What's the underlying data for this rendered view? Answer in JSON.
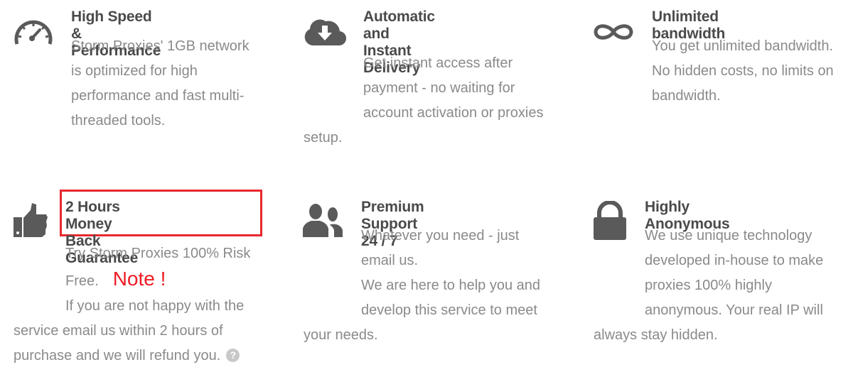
{
  "colors": {
    "icon": "#5a5a5a",
    "title": "#4a4a4a",
    "text": "#8a8a8a",
    "annotation": "#ee1c25"
  },
  "features": [
    {
      "icon": "speedometer-icon",
      "title": "High Speed & Performance",
      "lines": [
        "Storm Proxies' 1GB network",
        "is optimized for high",
        "performance and fast multi-",
        "threaded tools."
      ]
    },
    {
      "icon": "cloud-download-icon",
      "title_lines": [
        "Automatic and Instant",
        "Delivery"
      ],
      "lines": [
        "Get instant access after",
        "payment - no waiting for",
        "account activation or proxies",
        "setup."
      ]
    },
    {
      "icon": "infinity-icon",
      "title": "Unlimited bandwidth",
      "lines": [
        "You get unlimited bandwidth.",
        "No hidden costs, no limits on",
        "bandwidth."
      ]
    },
    {
      "icon": "thumbs-up-icon",
      "title_lines": [
        "2 Hours Money Back",
        "Guarantee"
      ],
      "lines": [
        "Try Storm Proxies 100% Risk",
        "Free.",
        "If you are not happy with the",
        "service email us within 2 hours of",
        "purchase and we will refund you."
      ],
      "note": "Note !",
      "help": "?"
    },
    {
      "icon": "users-icon",
      "title": "Premium Support 24 / 7",
      "lines": [
        "Whatever you need - just",
        "email us.",
        "We are here to help you and",
        "develop this service to meet",
        "your needs."
      ]
    },
    {
      "icon": "lock-icon",
      "title": "Highly Anonymous",
      "lines": [
        "We use unique technology",
        "developed in-house to make",
        "proxies 100% highly",
        "anonymous. Your real IP will",
        "always stay hidden."
      ]
    }
  ]
}
